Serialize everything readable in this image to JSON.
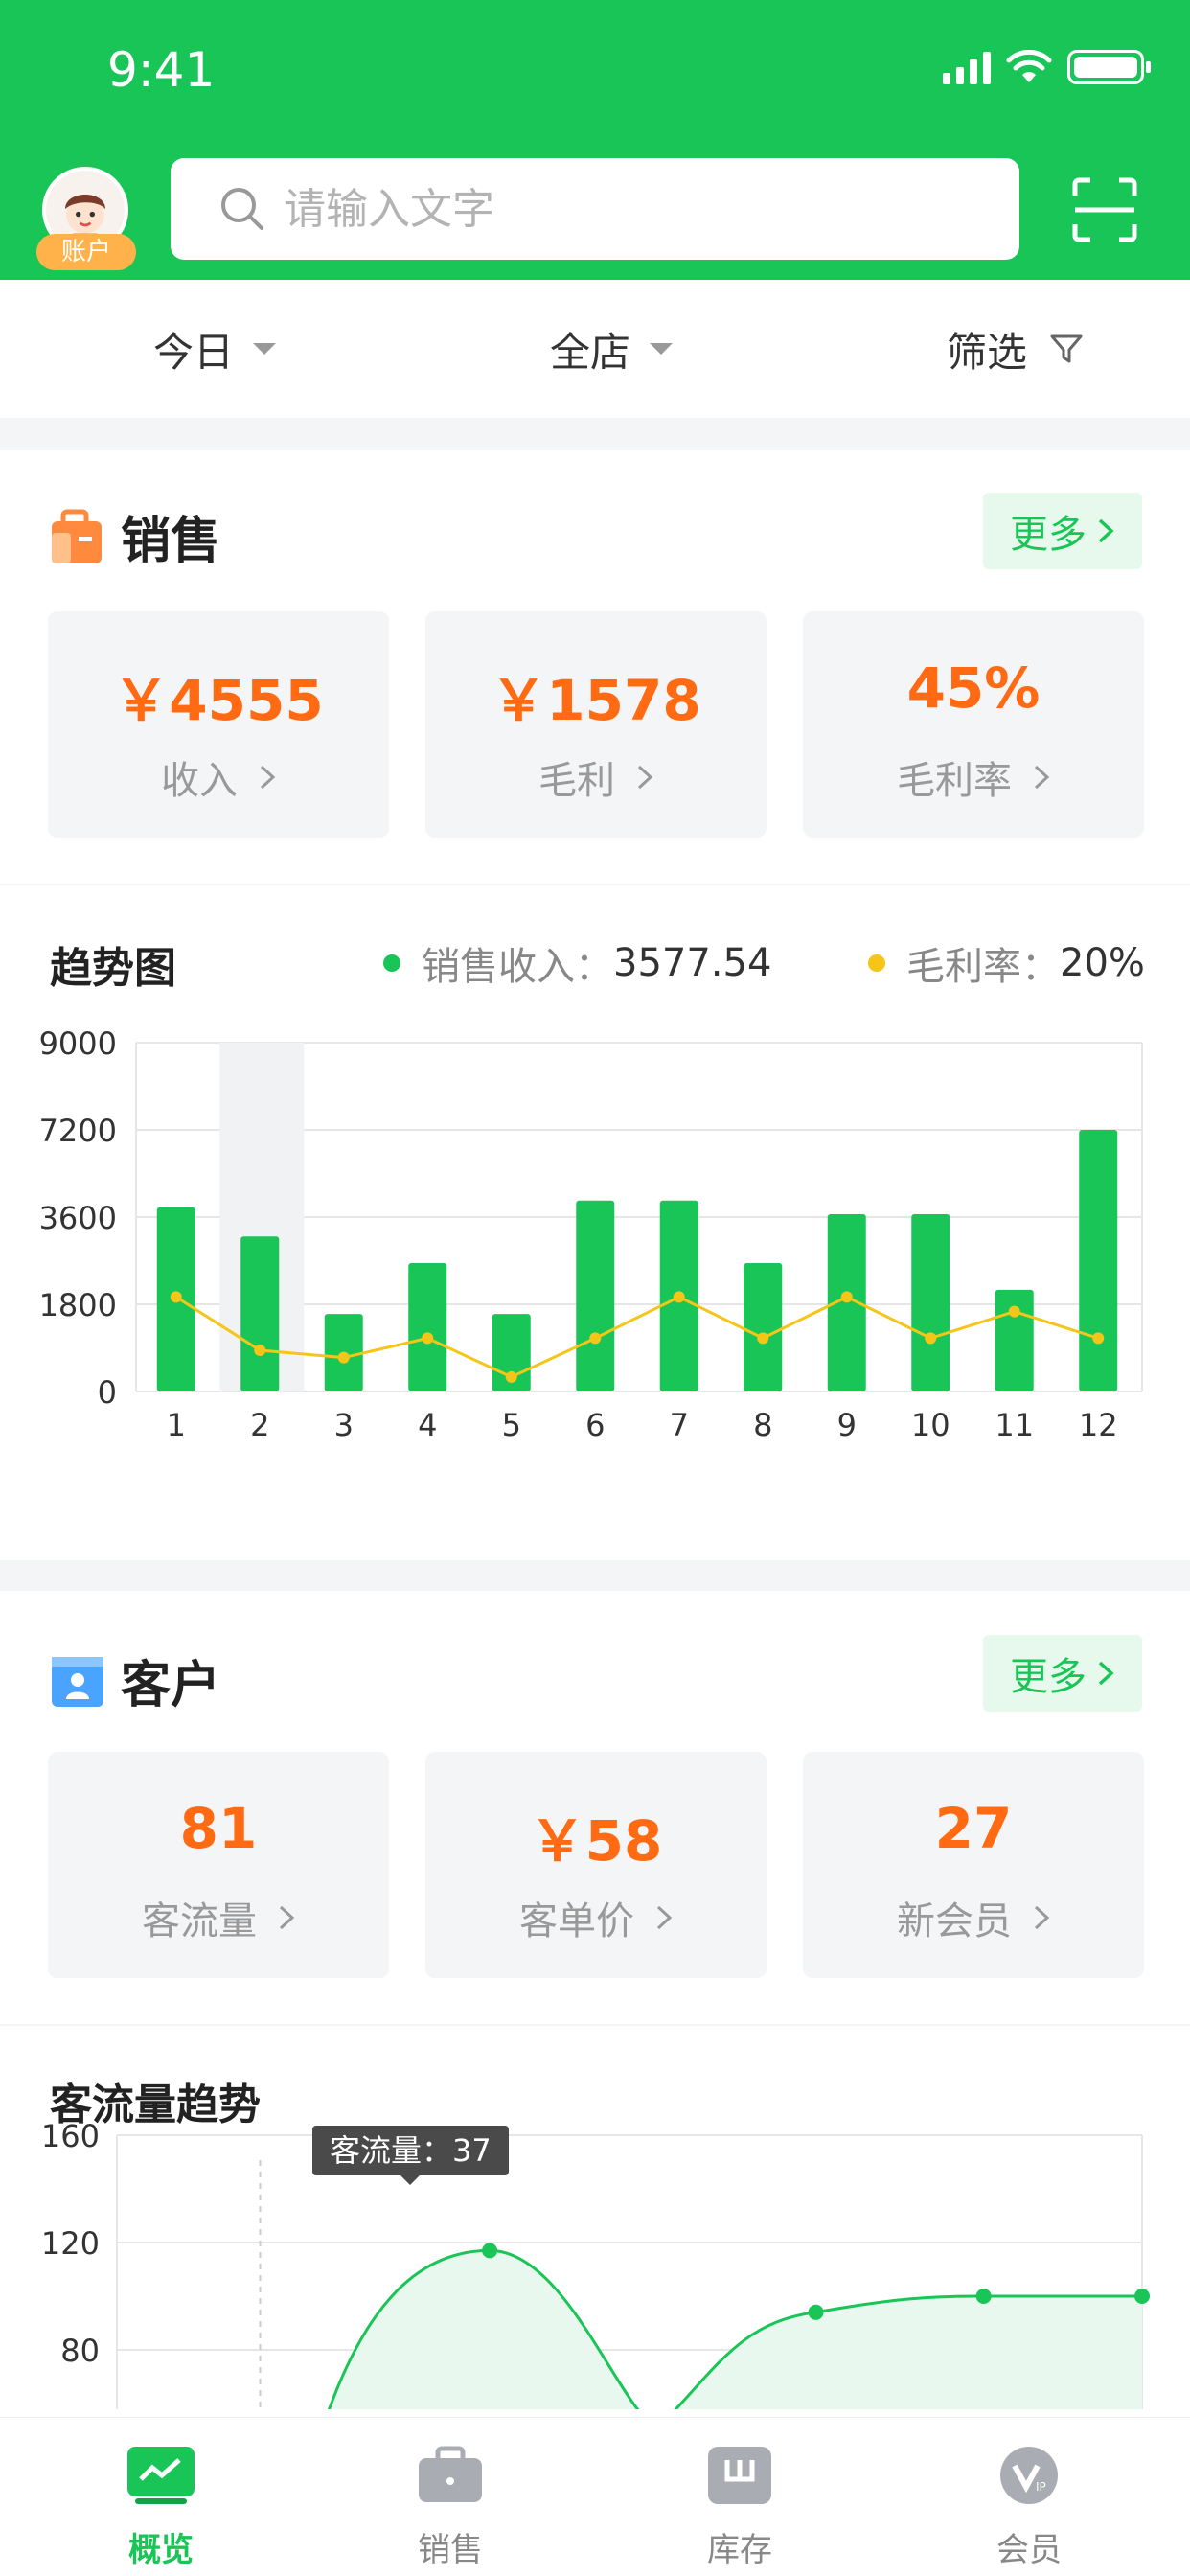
{
  "status": {
    "time": "9:41"
  },
  "header": {
    "avatar_badge": "账户",
    "search_placeholder": "请输入文字"
  },
  "filters": {
    "period": "今日",
    "store": "全店",
    "filter": "筛选"
  },
  "sales": {
    "title": "销售",
    "more": "更多",
    "stats": [
      {
        "value": "￥4555",
        "label": "收入"
      },
      {
        "value": "￥1578",
        "label": "毛利"
      },
      {
        "value": "45%",
        "label": "毛利率"
      }
    ]
  },
  "trend": {
    "title": "趋势图",
    "legend_revenue_label": "销售收入：",
    "legend_revenue_value": "3577.54",
    "legend_margin_label": "毛利率：",
    "legend_margin_value": "20%"
  },
  "customers": {
    "title": "客户",
    "more": "更多",
    "stats": [
      {
        "value": "81",
        "label": "客流量"
      },
      {
        "value": "￥58",
        "label": "客单价"
      },
      {
        "value": "27",
        "label": "新会员"
      }
    ]
  },
  "traffic": {
    "title": "客流量趋势",
    "tooltip": "客流量：37"
  },
  "tabs": [
    {
      "label": "概览"
    },
    {
      "label": "销售"
    },
    {
      "label": "库存"
    },
    {
      "label": "会员"
    }
  ],
  "colors": {
    "brand": "#19c557",
    "accent": "#ff6a13",
    "line": "#f5c518"
  },
  "chart_data": [
    {
      "type": "bar",
      "title": "趋势图",
      "categories": [
        "1",
        "2",
        "3",
        "4",
        "5",
        "6",
        "7",
        "8",
        "9",
        "10",
        "11",
        "12"
      ],
      "y_ticks": [
        0,
        1800,
        3600,
        7200,
        9000
      ],
      "series": [
        {
          "name": "销售收入",
          "type": "bar",
          "values": [
            4000,
            3200,
            1600,
            2650,
            1600,
            4280,
            4280,
            2650,
            3720,
            3720,
            2100,
            7200
          ]
        },
        {
          "name": "毛利率",
          "type": "line",
          "values": [
            1950,
            850,
            700,
            1100,
            300,
            1100,
            1950,
            1100,
            1950,
            1100,
            1650,
            1100
          ]
        }
      ],
      "highlighted_category": "2",
      "grid": true
    },
    {
      "type": "area",
      "title": "客流量趋势",
      "y_ticks": [
        80,
        120,
        160
      ],
      "tooltip_value": 37,
      "series": [
        {
          "name": "客流量",
          "points": [
            [
              3,
              37
            ],
            [
              5,
              117
            ],
            [
              6.8,
              68
            ],
            [
              8.5,
              94
            ],
            [
              10.3,
              100
            ],
            [
              12,
              100
            ]
          ]
        }
      ],
      "grid": true
    }
  ]
}
